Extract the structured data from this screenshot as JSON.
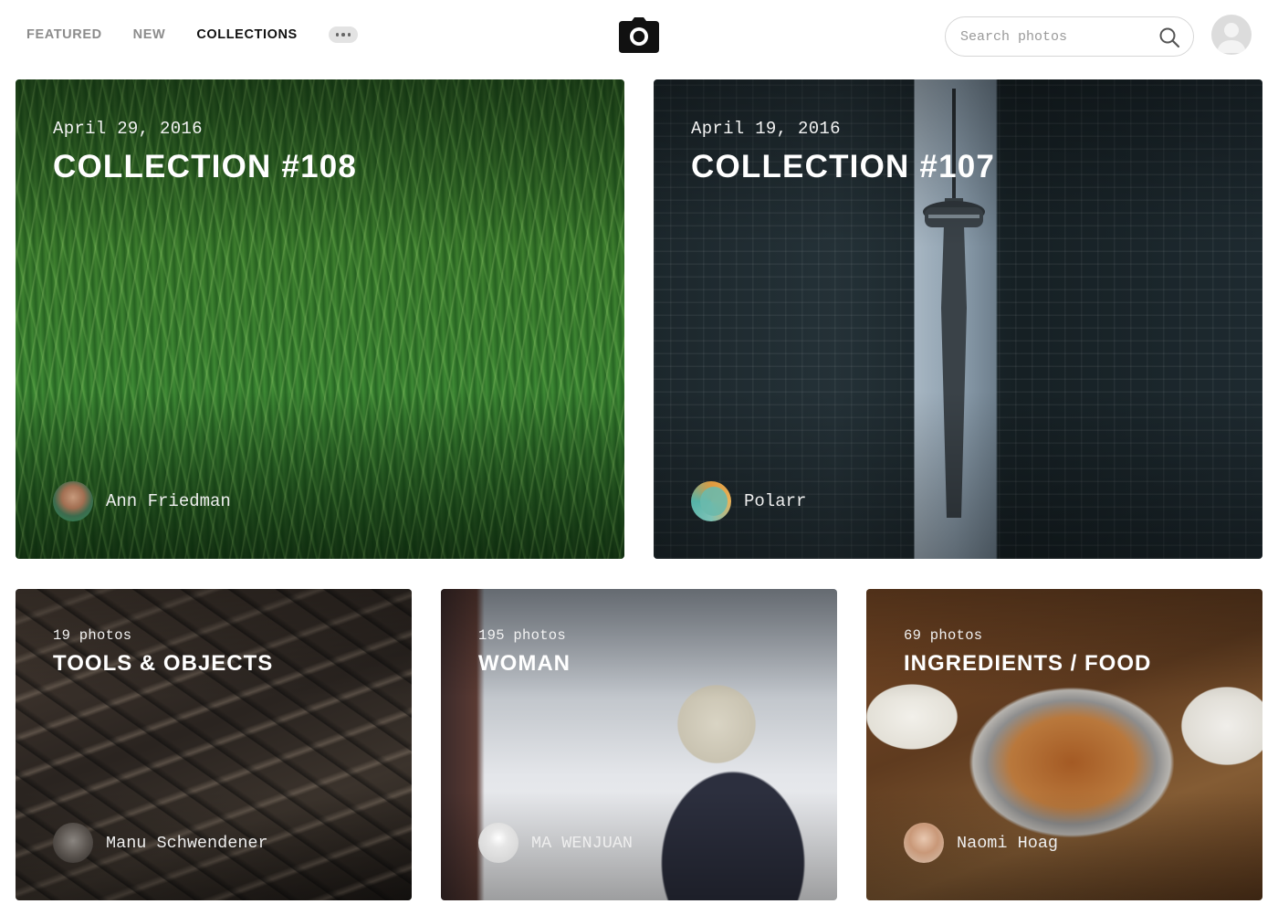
{
  "header": {
    "nav": [
      {
        "label": "FEATURED",
        "active": false
      },
      {
        "label": "NEW",
        "active": false
      },
      {
        "label": "COLLECTIONS",
        "active": true
      }
    ],
    "more_icon": "ellipsis-icon",
    "logo_icon": "camera-icon",
    "search": {
      "placeholder": "Search photos",
      "value": "",
      "icon": "search-icon"
    },
    "user_avatar": "user-avatar-placeholder"
  },
  "cards": [
    {
      "meta": "April 29, 2016",
      "title": "COLLECTION #108",
      "author": "Ann Friedman",
      "background": "green grass close-up"
    },
    {
      "meta": "April 19, 2016",
      "title": "COLLECTION #107",
      "author": "Polarr",
      "background": "CN tower between dark skyscrapers"
    },
    {
      "meta": "19 photos",
      "title": "TOOLS & OBJECTS",
      "author": "Manu Schwendener",
      "background": "wooden letterpress type"
    },
    {
      "meta": "195 photos",
      "title": "WOMAN",
      "author": "MA WENJUAN",
      "background": "person in knit hat on snowy street"
    },
    {
      "meta": "69 photos",
      "title": "INGREDIENTS / FOOD",
      "author": "Naomi Hoag",
      "background": "roast chicken on dinner table"
    }
  ],
  "colors": {
    "nav_inactive": "#8c8c8c",
    "nav_active": "#111111",
    "search_border": "#d6d6d6",
    "card_text": "#ffffff"
  }
}
